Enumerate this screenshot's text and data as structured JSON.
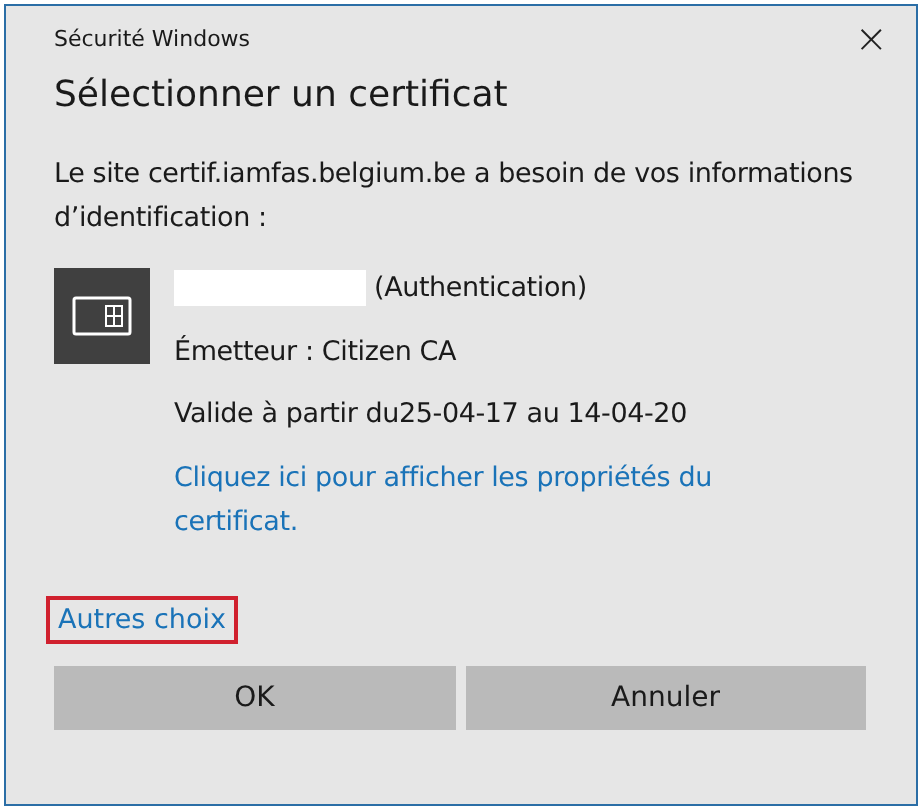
{
  "window": {
    "title": "Sécurité Windows",
    "close": "×"
  },
  "heading": "Sélectionner un certificat",
  "message": "Le site certif.iamfas.belgium.be a besoin de vos informations d’identification :",
  "certificate": {
    "name_suffix": "(Authentication)",
    "issuer": "Émetteur : Citizen CA",
    "validity": "Valide à partir du25-04-17 au 14-04-20",
    "properties_link": "Cliquez ici pour afficher les propriétés du certificat."
  },
  "more_choices": {
    "label": "Autres choix",
    "highlighted": true
  },
  "buttons": [
    "OK",
    "Annuler"
  ]
}
